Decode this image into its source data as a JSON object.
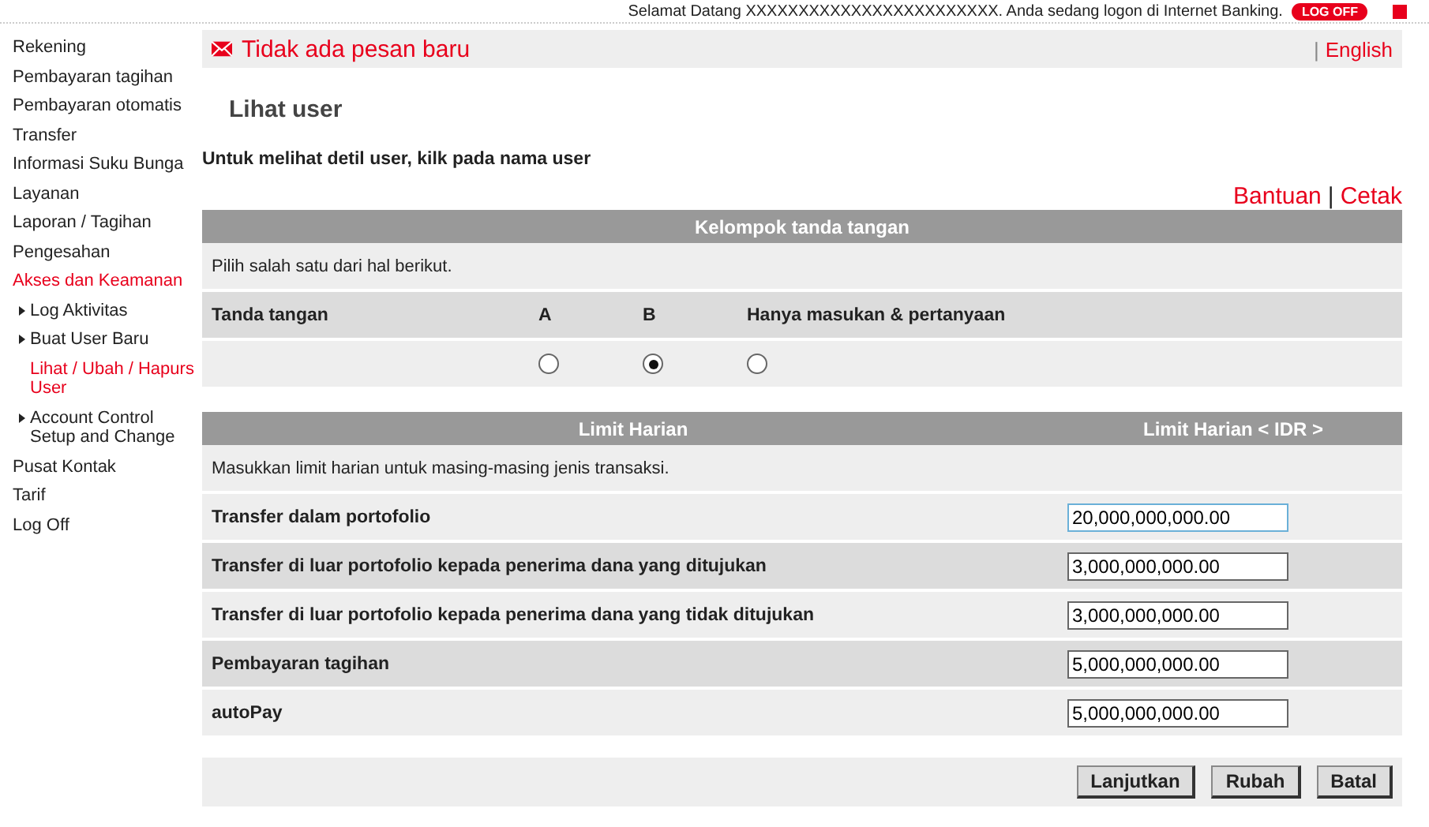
{
  "header": {
    "welcome": "Selamat Datang XXXXXXXXXXXXXXXXXXXXXXXX. Anda sedang logon di Internet Banking.",
    "logoff_button": "LOG OFF"
  },
  "sidebar": {
    "items": [
      {
        "label": "Rekening",
        "selected": false
      },
      {
        "label": "Pembayaran tagihan",
        "selected": false
      },
      {
        "label": "Pembayaran otomatis",
        "selected": false
      },
      {
        "label": "Transfer",
        "selected": false
      },
      {
        "label": "Informasi Suku Bunga",
        "selected": false
      },
      {
        "label": "Layanan",
        "selected": false
      },
      {
        "label": "Laporan / Tagihan",
        "selected": false
      },
      {
        "label": "Pengesahan",
        "selected": false
      },
      {
        "label": "Akses dan Keamanan",
        "selected": true,
        "children": [
          {
            "label": "Log Aktivitas",
            "selected": false
          },
          {
            "label": "Buat User Baru",
            "selected": false
          },
          {
            "label": "Lihat / Ubah / Hapurs User",
            "selected": true
          },
          {
            "label": "Account Control Setup and Change",
            "selected": false
          }
        ]
      },
      {
        "label": "Pusat Kontak",
        "selected": false
      },
      {
        "label": "Tarif",
        "selected": false
      },
      {
        "label": "Log Off",
        "selected": false
      }
    ]
  },
  "message_bar": {
    "message": "Tidak ada pesan baru",
    "separator": "|",
    "language_link": "English"
  },
  "page_title": "Lihat user",
  "instruction": "Untuk melihat detil user, kilk pada nama user",
  "links": {
    "help": "Bantuan",
    "separator": "|",
    "print": "Cetak"
  },
  "signature_group": {
    "title": "Kelompok tanda tangan",
    "hint": "Pilih salah satu dari hal berikut.",
    "row_label": "Tanda tangan",
    "options": [
      {
        "label": "A",
        "selected": false
      },
      {
        "label": "B",
        "selected": true
      },
      {
        "label": "Hanya masukan & pertanyaan",
        "selected": false
      }
    ]
  },
  "daily_limit": {
    "title": "Limit Harian",
    "amount_heading": "Limit Harian < IDR >",
    "hint": "Masukkan limit harian untuk masing-masing jenis transaksi.",
    "rows": [
      {
        "label": "Transfer dalam portofolio",
        "value": "20,000,000,000.00",
        "focused": true
      },
      {
        "label": "Transfer di luar portofolio kepada penerima dana yang ditujukan",
        "value": "3,000,000,000.00",
        "focused": false
      },
      {
        "label": "Transfer di luar portofolio kepada penerima dana yang tidak ditujukan",
        "value": "3,000,000,000.00",
        "focused": false
      },
      {
        "label": "Pembayaran tagihan",
        "value": "5,000,000,000.00",
        "focused": false
      },
      {
        "label": "autoPay",
        "value": "5,000,000,000.00",
        "focused": false
      }
    ]
  },
  "buttons": [
    "Lanjutkan",
    "Rubah",
    "Batal"
  ]
}
